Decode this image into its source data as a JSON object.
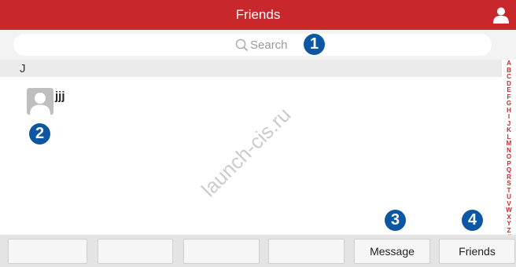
{
  "header": {
    "title": "Friends",
    "profile_icon": "user-icon"
  },
  "search": {
    "placeholder": "Search",
    "icon": "search-icon"
  },
  "callouts": [
    "1",
    "2",
    "3",
    "4"
  ],
  "friends": {
    "sections": [
      {
        "letter": "J",
        "items": [
          {
            "name": "jjj",
            "avatar_icon": "person-icon"
          }
        ]
      }
    ]
  },
  "alphabet_index": [
    "A",
    "B",
    "C",
    "D",
    "E",
    "F",
    "G",
    "H",
    "I",
    "J",
    "K",
    "L",
    "M",
    "N",
    "O",
    "P",
    "Q",
    "R",
    "S",
    "T",
    "U",
    "V",
    "W",
    "X",
    "Y",
    "Z",
    "#"
  ],
  "watermark": "launch-cis.ru",
  "bottom_bar": {
    "buttons": [
      {
        "label": ""
      },
      {
        "label": ""
      },
      {
        "label": ""
      },
      {
        "label": ""
      },
      {
        "label": "Message"
      },
      {
        "label": "Friends"
      }
    ]
  },
  "colors": {
    "accent": "#c8272c",
    "callout": "#0b57a4",
    "background": "#ffffff"
  }
}
